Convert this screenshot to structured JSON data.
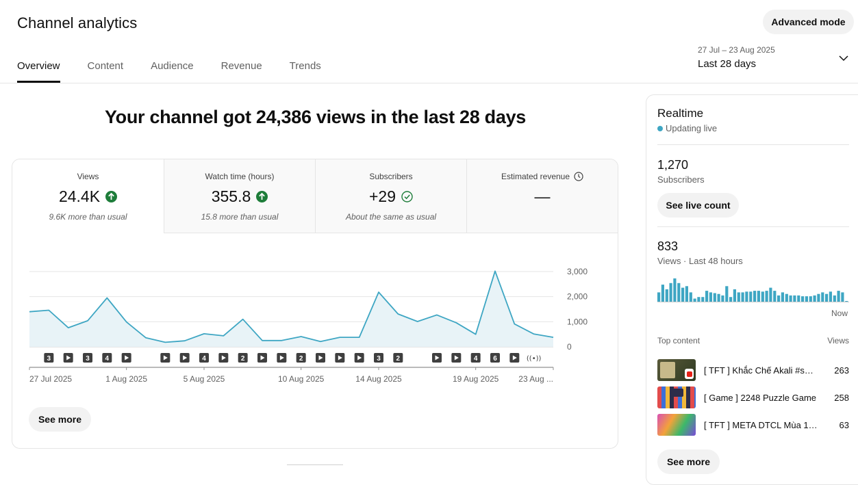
{
  "header": {
    "title": "Channel analytics",
    "advanced_mode": "Advanced mode"
  },
  "tabs": [
    {
      "label": "Overview",
      "active": true
    },
    {
      "label": "Content",
      "active": false
    },
    {
      "label": "Audience",
      "active": false
    },
    {
      "label": "Revenue",
      "active": false
    },
    {
      "label": "Trends",
      "active": false
    }
  ],
  "date_range": {
    "range": "27 Jul – 23 Aug 2025",
    "label": "Last 28 days",
    "icon": "chevron-down-icon"
  },
  "headline": "Your channel got 24,386 views in the last 28 days",
  "metrics": [
    {
      "label": "Views",
      "value": "24.4K",
      "status_icon": "arrow-up-icon",
      "sub": "9.6K more than usual"
    },
    {
      "label": "Watch time (hours)",
      "value": "355.8",
      "status_icon": "arrow-up-icon",
      "sub": "15.8 more than usual"
    },
    {
      "label": "Subscribers",
      "value": "+29",
      "status_icon": "check-circle-icon",
      "sub": "About the same as usual"
    },
    {
      "label": "Estimated revenue",
      "value": "—",
      "status_icon": "clock-icon",
      "sub": ""
    }
  ],
  "colors": {
    "line": "#3ea6c3",
    "area": "#e8f3f7",
    "up_green": "#1e7d3a",
    "live_dot": "#3ea6c3"
  },
  "chart_data": {
    "type": "area",
    "x": [
      "27 Jul 2025",
      "28 Jul 2025",
      "29 Jul 2025",
      "30 Jul 2025",
      "31 Jul 2025",
      "1 Aug 2025",
      "2 Aug 2025",
      "3 Aug 2025",
      "4 Aug 2025",
      "5 Aug 2025",
      "6 Aug 2025",
      "7 Aug 2025",
      "8 Aug 2025",
      "9 Aug 2025",
      "10 Aug 2025",
      "11 Aug 2025",
      "12 Aug 2025",
      "13 Aug 2025",
      "14 Aug 2025",
      "15 Aug 2025",
      "16 Aug 2025",
      "17 Aug 2025",
      "18 Aug 2025",
      "19 Aug 2025",
      "20 Aug 2025",
      "21 Aug 2025",
      "22 Aug 2025",
      "23 Aug 2025"
    ],
    "series": [
      {
        "values": [
          1400,
          1460,
          760,
          1040,
          1950,
          990,
          360,
          180,
          240,
          520,
          440,
          1100,
          250,
          250,
          410,
          210,
          380,
          380,
          2180,
          1310,
          1010,
          1270,
          960,
          500,
          3020,
          910,
          510,
          380
        ]
      }
    ],
    "yticks": [
      "3,000",
      "2,000",
      "1,000",
      "0"
    ],
    "ylim": [
      0,
      3000
    ],
    "xtick_labels": [
      "27 Jul 2025",
      "1 Aug 2025",
      "5 Aug 2025",
      "10 Aug 2025",
      "14 Aug 2025",
      "19 Aug 2025",
      "23 Aug ..."
    ],
    "xtick_days": [
      0,
      5,
      9,
      14,
      18,
      23,
      27
    ],
    "grid": true
  },
  "publish_markers": [
    {
      "day": 1,
      "label": "3"
    },
    {
      "day": 2,
      "label": "play"
    },
    {
      "day": 3,
      "label": "3"
    },
    {
      "day": 4,
      "label": "4"
    },
    {
      "day": 5,
      "label": "play"
    },
    {
      "day": 7,
      "label": "play"
    },
    {
      "day": 8,
      "label": "play"
    },
    {
      "day": 9,
      "label": "4"
    },
    {
      "day": 10,
      "label": "play"
    },
    {
      "day": 11,
      "label": "2"
    },
    {
      "day": 12,
      "label": "play"
    },
    {
      "day": 13,
      "label": "play"
    },
    {
      "day": 14,
      "label": "2"
    },
    {
      "day": 15,
      "label": "play"
    },
    {
      "day": 16,
      "label": "play"
    },
    {
      "day": 17,
      "label": "play"
    },
    {
      "day": 18,
      "label": "3"
    },
    {
      "day": 19,
      "label": "2"
    },
    {
      "day": 21,
      "label": "play"
    },
    {
      "day": 22,
      "label": "play"
    },
    {
      "day": 23,
      "label": "4"
    },
    {
      "day": 24,
      "label": "6"
    },
    {
      "day": 25,
      "label": "play"
    },
    {
      "day": 26,
      "label": "live"
    }
  ],
  "see_more": "See more",
  "realtime": {
    "title": "Realtime",
    "status": "Updating live",
    "subscribers_value": "1,270",
    "subscribers_label": "Subscribers",
    "see_live_count": "See live count",
    "views_value": "833",
    "views_label": "Views · Last 48 hours",
    "now_label": "Now",
    "bars": [
      12,
      22,
      16,
      24,
      30,
      24,
      18,
      20,
      12,
      4,
      6,
      6,
      14,
      12,
      11,
      10,
      8,
      20,
      6,
      16,
      12,
      12,
      13,
      13,
      14,
      14,
      13,
      14,
      18,
      14,
      8,
      12,
      10,
      8,
      8,
      8,
      7,
      7,
      7,
      8,
      10,
      12,
      10,
      13,
      8,
      14,
      12,
      0
    ],
    "top_content_label": "Top content",
    "views_col_label": "Views",
    "top_content": [
      {
        "title": "[ TFT ] Khắc Chế Akali #shorts",
        "views": "263"
      },
      {
        "title": "[ Game ] 2248 Puzzle Game",
        "views": "258"
      },
      {
        "title": "[ TFT ] META DTCL Mùa 15 - Đội hình",
        "views": "63"
      }
    ],
    "see_more": "See more"
  }
}
